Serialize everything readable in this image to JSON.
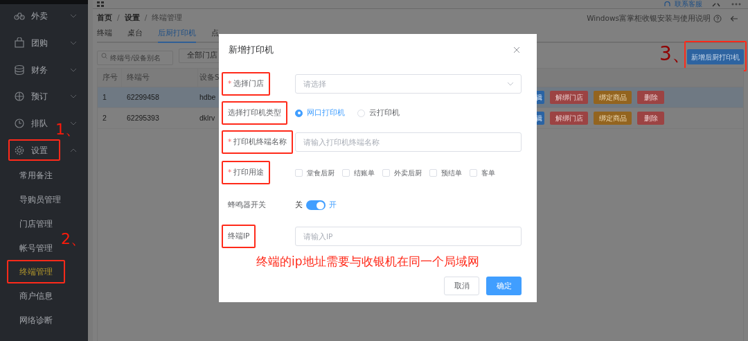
{
  "top_bar": {
    "contact": "联系客服"
  },
  "sidebar": {
    "items": [
      {
        "label": "外卖",
        "expanded": false,
        "boxed": false
      },
      {
        "label": "团购",
        "expanded": false,
        "boxed": false
      },
      {
        "label": "财务",
        "expanded": false,
        "boxed": false
      },
      {
        "label": "预订",
        "expanded": false,
        "boxed": false
      },
      {
        "label": "排队",
        "expanded": false,
        "boxed": false
      },
      {
        "label": "设置",
        "expanded": true,
        "boxed": true,
        "children": [
          {
            "label": "常用备注",
            "selected": false,
            "boxed": false
          },
          {
            "label": "导购员管理",
            "selected": false,
            "boxed": false
          },
          {
            "label": "门店管理",
            "selected": false,
            "boxed": false
          },
          {
            "label": "帐号管理",
            "selected": false,
            "boxed": false
          },
          {
            "label": "终端管理",
            "selected": true,
            "boxed": true
          },
          {
            "label": "商户信息",
            "selected": false,
            "boxed": false
          },
          {
            "label": "网络诊断",
            "selected": false,
            "boxed": false
          }
        ]
      }
    ]
  },
  "breadcrumb": {
    "items": [
      "首页",
      "设置",
      "终端管理"
    ],
    "separator": "/"
  },
  "help_link": "Windows富掌柜收银安装与使用说明",
  "tabs": [
    {
      "label": "终端",
      "selected": false
    },
    {
      "label": "桌台",
      "selected": false
    },
    {
      "label": "后厨打印机",
      "selected": true
    },
    {
      "label": "点",
      "selected": false
    }
  ],
  "toolbar": {
    "search_placeholder": "终端号/设备别名",
    "store_filter": "全部门店",
    "add_button": "新增后厨打印机",
    "add_button_boxed": true
  },
  "table": {
    "columns": [
      "序号",
      "终端号",
      "设备S"
    ],
    "rows": [
      {
        "cells": [
          "1",
          "62299458",
          "hdbe"
        ],
        "selected": true,
        "actions": [
          "辑",
          "解绑门店",
          "绑定商品",
          "删除"
        ]
      },
      {
        "cells": [
          "2",
          "62295393",
          "dklrv"
        ],
        "selected": false,
        "actions": [
          "辑",
          "解绑门店",
          "绑定商品",
          "删除"
        ]
      }
    ]
  },
  "dialog": {
    "title": "新增打印机",
    "required_mark": "*",
    "fields": [
      {
        "kind": "select",
        "label": "选择门店",
        "required": true,
        "boxed": true,
        "placeholder": "请选择"
      },
      {
        "kind": "radio",
        "label": "选择打印机类型",
        "required": false,
        "boxed": true,
        "options": [
          {
            "label": "网口打印机",
            "selected": true
          },
          {
            "label": "云打印机",
            "selected": false
          }
        ]
      },
      {
        "kind": "input",
        "label": "打印机终端名称",
        "required": true,
        "boxed": true,
        "placeholder": "请输入打印机终端名称"
      },
      {
        "kind": "checkboxes",
        "label": "打印用途",
        "required": true,
        "boxed": true,
        "options": [
          {
            "label": "堂食后厨",
            "checked": false
          },
          {
            "label": "结账单",
            "checked": false
          },
          {
            "label": "外卖后厨",
            "checked": false
          },
          {
            "label": "预结单",
            "checked": false
          },
          {
            "label": "客单",
            "checked": false
          }
        ]
      },
      {
        "kind": "switch",
        "label": "蜂鸣器开关",
        "required": false,
        "boxed": false,
        "off_label": "关",
        "on_label": "开",
        "on": true
      },
      {
        "kind": "input",
        "label": "终端IP",
        "required": false,
        "boxed": true,
        "placeholder": "请输入IP"
      }
    ],
    "note": "终端的ip地址需要与收银机在同一个局域网",
    "buttons": [
      {
        "label": "取消",
        "kind": "secondary"
      },
      {
        "label": "确定",
        "kind": "primary"
      }
    ]
  },
  "annotations": [
    "1、",
    "2、",
    "3、"
  ]
}
